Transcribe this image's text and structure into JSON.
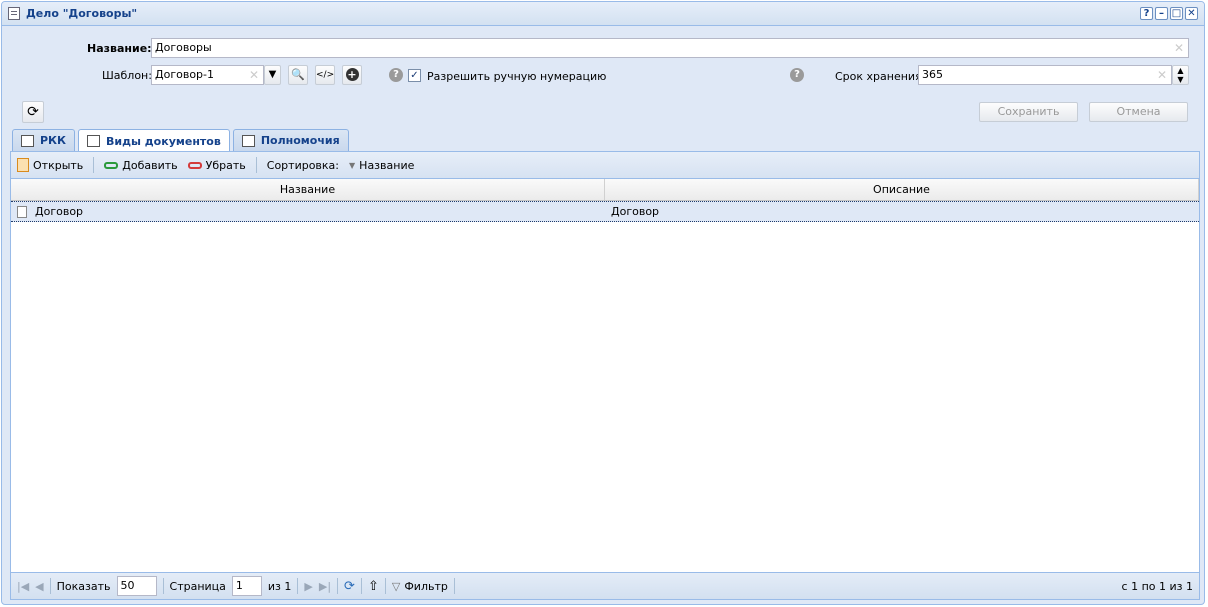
{
  "window": {
    "title": "Дело \"Договоры\"",
    "tools": [
      "?",
      "–",
      "□",
      "✕"
    ]
  },
  "form": {
    "name_label": "Название:",
    "name_value": "Договоры",
    "template_label": "Шаблон:",
    "template_value": "Договор-1",
    "allow_manual_label": "Разрешить ручную нумерацию",
    "allow_manual_checked": true,
    "retention_label": "Срок хранения:",
    "retention_value": "365",
    "save_label": "Сохранить",
    "cancel_label": "Отмена"
  },
  "tabs": [
    {
      "label": "РКК",
      "active": false
    },
    {
      "label": "Виды документов",
      "active": true
    },
    {
      "label": "Полномочия",
      "active": false
    }
  ],
  "toolbar": {
    "open_label": "Открыть",
    "add_label": "Добавить",
    "remove_label": "Убрать",
    "sort_label": "Сортировка:",
    "sort_field": "Название"
  },
  "grid": {
    "columns": [
      "Название",
      "Описание"
    ],
    "rows": [
      {
        "name": "Договор",
        "description": "Договор"
      }
    ]
  },
  "pager": {
    "show_label": "Показать",
    "page_size": "50",
    "page_label": "Страница",
    "page_value": "1",
    "of_label": "из 1",
    "filter_label": "Фильтр",
    "summary": "с 1 по 1 из 1"
  },
  "colors": {
    "accent": "#15428b",
    "frame": "#99bbe8",
    "background": "#dfe8f6"
  }
}
